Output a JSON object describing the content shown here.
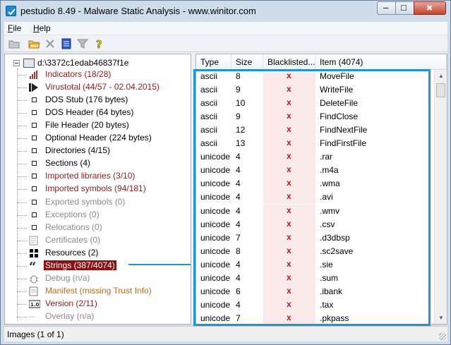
{
  "window": {
    "title": "pestudio 8.49 - Malware Static Analysis - www.winitor.com",
    "minimize_glyph": "–",
    "maximize_glyph": "□",
    "close_glyph": "✖"
  },
  "menu": {
    "items": [
      {
        "label_first": "F",
        "label_rest": "ile"
      },
      {
        "label_first": "H",
        "label_rest": "elp"
      }
    ]
  },
  "toolbar": {
    "icons": [
      "open-folder-icon",
      "open-file-icon",
      "close-x-icon",
      "save-list-icon",
      "filter-icon",
      "help-icon"
    ]
  },
  "tree": {
    "root": {
      "label": "d:\\3372c1edab46837f1e",
      "icon": "computer-icon"
    },
    "items": [
      {
        "label": "Indicators (18/28)",
        "color": "red",
        "icon": "bar-chart-icon"
      },
      {
        "label": "Virustotal (44/57 - 02.04.2015)",
        "color": "red",
        "icon": "play-arrow-icon"
      },
      {
        "label": "DOS Stub (176 bytes)",
        "color": "black",
        "icon": "square-icon"
      },
      {
        "label": "DOS Header (64 bytes)",
        "color": "black",
        "icon": "square-icon"
      },
      {
        "label": "File Header (20 bytes)",
        "color": "black",
        "icon": "square-icon"
      },
      {
        "label": "Optional Header (224 bytes)",
        "color": "black",
        "icon": "square-icon"
      },
      {
        "label": "Directories (4/15)",
        "color": "black",
        "icon": "square-icon"
      },
      {
        "label": "Sections (4)",
        "color": "black",
        "icon": "square-icon"
      },
      {
        "label": "Imported libraries (3/10)",
        "color": "red",
        "icon": "square-icon"
      },
      {
        "label": "Imported symbols (94/181)",
        "color": "red",
        "icon": "square-icon"
      },
      {
        "label": "Exported symbols (0)",
        "color": "gray",
        "icon": "square-icon"
      },
      {
        "label": "Exceptions (0)",
        "color": "gray",
        "icon": "square-icon"
      },
      {
        "label": "Relocations (0)",
        "color": "gray",
        "icon": "square-icon"
      },
      {
        "label": "Certificates (0)",
        "color": "gray",
        "icon": "certificate-icon"
      },
      {
        "label": "Resources (2)",
        "color": "black",
        "icon": "resources-grid-icon"
      },
      {
        "label": "Strings (387/4074)",
        "color": "black",
        "icon": "quote-icon",
        "selected": true
      },
      {
        "label": "Debug (n/a)",
        "color": "gray",
        "icon": "bug-icon"
      },
      {
        "label": "Manifest (missing Trust Info)",
        "color": "orange",
        "icon": "manifest-icon"
      },
      {
        "label": "Version (2/11)",
        "color": "red",
        "icon": "version-icon"
      },
      {
        "label": "Overlay (n/a)",
        "color": "gray",
        "icon": "dotted-leaf-icon"
      }
    ]
  },
  "list": {
    "columns": [
      "Type",
      "Size",
      "Blacklisted...",
      "Item (4074)"
    ],
    "blacklist_mark": "x",
    "rows": [
      {
        "type": "ascii",
        "size": "8",
        "item": "MoveFile"
      },
      {
        "type": "ascii",
        "size": "9",
        "item": "WriteFile"
      },
      {
        "type": "ascii",
        "size": "10",
        "item": "DeleteFile"
      },
      {
        "type": "ascii",
        "size": "9",
        "item": "FindClose"
      },
      {
        "type": "ascii",
        "size": "12",
        "item": "FindNextFile"
      },
      {
        "type": "ascii",
        "size": "13",
        "item": "FindFirstFile"
      },
      {
        "type": "unicode",
        "size": "4",
        "item": ".rar"
      },
      {
        "type": "unicode",
        "size": "4",
        "item": ".m4a"
      },
      {
        "type": "unicode",
        "size": "4",
        "item": ".wma"
      },
      {
        "type": "unicode",
        "size": "4",
        "item": ".avi"
      },
      {
        "type": "unicode",
        "size": "4",
        "item": ".wmv"
      },
      {
        "type": "unicode",
        "size": "4",
        "item": ".csv"
      },
      {
        "type": "unicode",
        "size": "7",
        "item": ".d3dbsp"
      },
      {
        "type": "unicode",
        "size": "8",
        "item": ".sc2save"
      },
      {
        "type": "unicode",
        "size": "4",
        "item": ".sie"
      },
      {
        "type": "unicode",
        "size": "4",
        "item": ".sum"
      },
      {
        "type": "unicode",
        "size": "6",
        "item": ".ibank"
      },
      {
        "type": "unicode",
        "size": "4",
        "item": ".tax"
      },
      {
        "type": "unicode",
        "size": "7",
        "item": ".pkpass"
      }
    ]
  },
  "status": {
    "text": "Images (1 of 1)"
  },
  "colors": {
    "accent_blue": "#1b97d6",
    "selected_bg": "#8e1111",
    "red_text": "#a21b1b",
    "orange_text": "#c76b12",
    "gray_text": "#8a8a8a"
  }
}
